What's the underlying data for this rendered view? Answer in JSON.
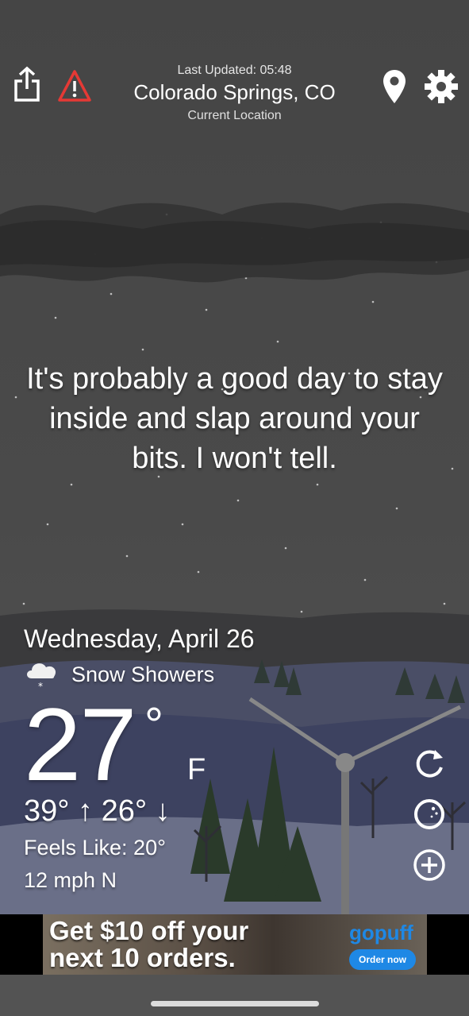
{
  "header": {
    "last_updated": "Last Updated: 05:48",
    "location": "Colorado Springs, CO",
    "location_sub": "Current Location"
  },
  "quote": "It's probably a good day to stay inside and slap around your bits. I won't tell.",
  "weather": {
    "date": "Wednesday, April 26",
    "condition": "Snow Showers",
    "temperature": "27",
    "degree_symbol": "°",
    "unit": "F",
    "high_low": "39° ↑  26° ↓",
    "feels_like": "Feels Like: 20°",
    "wind": "12 mph N"
  },
  "icons": {
    "share": "share-icon",
    "alert": "alert-triangle-icon",
    "location": "location-pin-icon",
    "settings": "gear-icon",
    "condition": "snow-cloud-icon",
    "refresh": "refresh-icon",
    "radar": "radar-icon",
    "add": "plus-circle-icon"
  },
  "ad": {
    "headline_line1": "Get $10 off your",
    "headline_line2": "next 10 orders.",
    "brand": "gopuff",
    "cta": "Order now"
  },
  "colors": {
    "alert": "#e53935",
    "ad_accent": "#1e88e5"
  }
}
